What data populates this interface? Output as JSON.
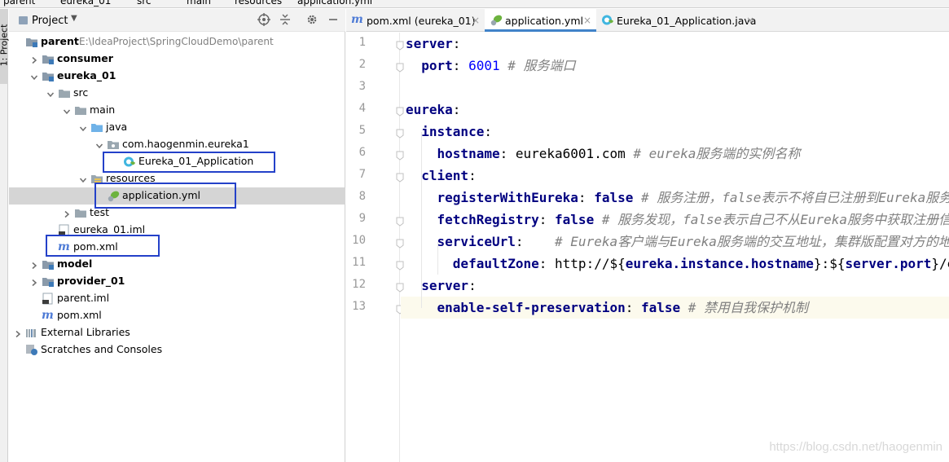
{
  "breadcrumb": [
    "parent",
    "eureka_01",
    "src",
    "main",
    "resources",
    "application.yml"
  ],
  "side_tab": "1: Project",
  "project_panel": {
    "title": "Project",
    "tree": [
      {
        "label": "parent",
        "path": "E:\\IdeaProject\\SpringCloudDemo\\parent",
        "bold": true,
        "icon": "module-folder-icon",
        "arrow": "none"
      },
      {
        "label": "consumer",
        "bold": true,
        "icon": "module-folder-icon",
        "arrow": "right"
      },
      {
        "label": "eureka_01",
        "bold": true,
        "icon": "module-folder-icon",
        "arrow": "down"
      },
      {
        "label": "src",
        "icon": "folder-icon",
        "arrow": "down"
      },
      {
        "label": "main",
        "icon": "folder-icon",
        "arrow": "down"
      },
      {
        "label": "java",
        "icon": "source-folder-icon",
        "arrow": "down"
      },
      {
        "label": "com.haogenmin.eureka1",
        "icon": "package-icon",
        "arrow": "down"
      },
      {
        "label": "Eureka_01_Application",
        "icon": "spring-boot-class-icon",
        "arrow": "none"
      },
      {
        "label": "resources",
        "icon": "resources-folder-icon",
        "arrow": "down"
      },
      {
        "label": "application.yml",
        "icon": "spring-yml-icon",
        "arrow": "none",
        "selected": true
      },
      {
        "label": "test",
        "icon": "folder-icon",
        "arrow": "right"
      },
      {
        "label": "eureka_01.iml",
        "icon": "iml-file-icon",
        "arrow": "none"
      },
      {
        "label": "pom.xml",
        "icon": "maven-icon",
        "arrow": "none"
      },
      {
        "label": "model",
        "bold": true,
        "icon": "module-folder-icon",
        "arrow": "right"
      },
      {
        "label": "provider_01",
        "bold": true,
        "icon": "module-folder-icon",
        "arrow": "right"
      },
      {
        "label": "parent.iml",
        "icon": "iml-file-icon",
        "arrow": "none"
      },
      {
        "label": "pom.xml",
        "icon": "maven-icon",
        "arrow": "none"
      },
      {
        "label": "External Libraries",
        "icon": "libraries-icon",
        "arrow": "right"
      },
      {
        "label": "Scratches and Consoles",
        "icon": "scratches-icon",
        "arrow": "none"
      }
    ]
  },
  "editor": {
    "tabs": [
      {
        "label": "pom.xml (eureka_01)",
        "icon": "maven-icon",
        "active": false
      },
      {
        "label": "application.yml",
        "icon": "spring-yml-icon",
        "active": true
      },
      {
        "label": "Eureka_01_Application.java",
        "icon": "spring-boot-class-icon",
        "active": false
      }
    ],
    "line_numbers": [
      "1",
      "2",
      "3",
      "4",
      "5",
      "6",
      "7",
      "8",
      "9",
      "10",
      "11",
      "12",
      "13"
    ],
    "lines": [
      [
        {
          "t": "server",
          "c": "k"
        },
        {
          "t": ":",
          "c": "pl"
        }
      ],
      [
        {
          "t": "  ",
          "c": "pl"
        },
        {
          "t": "port",
          "c": "k"
        },
        {
          "t": ": ",
          "c": "pl"
        },
        {
          "t": "6001",
          "c": "num"
        },
        {
          "t": " # 服务端口",
          "c": "cm"
        }
      ],
      [],
      [
        {
          "t": "eureka",
          "c": "k"
        },
        {
          "t": ":",
          "c": "pl"
        }
      ],
      [
        {
          "t": "  ",
          "c": "pl"
        },
        {
          "t": "instance",
          "c": "k"
        },
        {
          "t": ":",
          "c": "pl"
        }
      ],
      [
        {
          "t": "    ",
          "c": "pl"
        },
        {
          "t": "hostname",
          "c": "k"
        },
        {
          "t": ": eureka6001.com",
          "c": "pl"
        },
        {
          "t": " # eureka服务端的实例名称",
          "c": "cm"
        }
      ],
      [
        {
          "t": "  ",
          "c": "pl"
        },
        {
          "t": "client",
          "c": "k"
        },
        {
          "t": ":",
          "c": "pl"
        }
      ],
      [
        {
          "t": "    ",
          "c": "pl"
        },
        {
          "t": "registerWithEureka",
          "c": "k"
        },
        {
          "t": ": ",
          "c": "pl"
        },
        {
          "t": "false",
          "c": "k"
        },
        {
          "t": " # 服务注册，false表示不将自已注册到Eureka服务中",
          "c": "cm"
        }
      ],
      [
        {
          "t": "    ",
          "c": "pl"
        },
        {
          "t": "fetchRegistry",
          "c": "k"
        },
        {
          "t": ": ",
          "c": "pl"
        },
        {
          "t": "false",
          "c": "k"
        },
        {
          "t": " # 服务发现，false表示自己不从Eureka服务中获取注册信息",
          "c": "cm"
        }
      ],
      [
        {
          "t": "    ",
          "c": "pl"
        },
        {
          "t": "serviceUrl",
          "c": "k"
        },
        {
          "t": ":    ",
          "c": "pl"
        },
        {
          "t": "# Eureka客户端与Eureka服务端的交互地址，集群版配置对方的地址",
          "c": "cm"
        }
      ],
      [
        {
          "t": "      ",
          "c": "pl"
        },
        {
          "t": "defaultZone",
          "c": "k"
        },
        {
          "t": ": http://${",
          "c": "pl"
        },
        {
          "t": "eureka.instance.hostname",
          "c": "k"
        },
        {
          "t": "}:${",
          "c": "pl"
        },
        {
          "t": "server.port",
          "c": "k"
        },
        {
          "t": "}/eureka/",
          "c": "pl"
        }
      ],
      [
        {
          "t": "  ",
          "c": "pl"
        },
        {
          "t": "server",
          "c": "k"
        },
        {
          "t": ":",
          "c": "pl"
        }
      ],
      [
        {
          "t": "    ",
          "c": "pl"
        },
        {
          "t": "enable-self-preservation",
          "c": "k"
        },
        {
          "t": ": ",
          "c": "pl"
        },
        {
          "t": "false",
          "c": "k"
        },
        {
          "t": " # 禁用自我保护机制",
          "c": "cm"
        }
      ]
    ]
  },
  "watermark": "https://blog.csdn.net/haogenmin",
  "colors": {
    "keyword": "#000080",
    "number": "#0000ff",
    "comment": "#808080",
    "annotation_box": "#2441c9",
    "active_tab_underline": "#4083c9",
    "selected_row": "#d5d5d5"
  }
}
